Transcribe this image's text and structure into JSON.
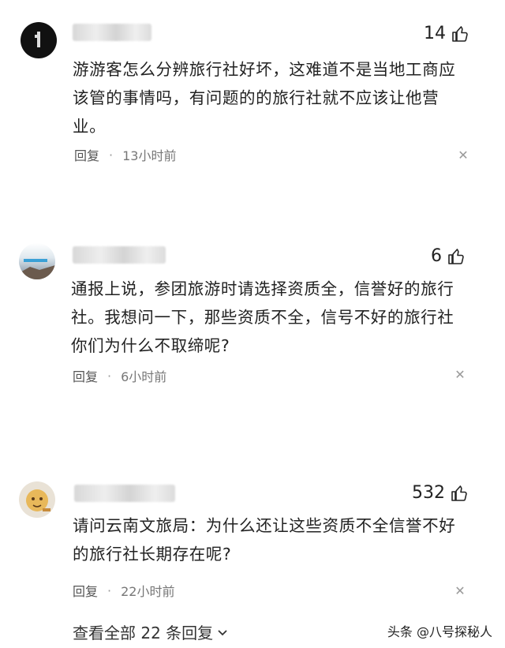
{
  "comments": [
    {
      "likes": "14",
      "text": "游游客怎么分辨旅行社好坏，这难道不是当地工商应该管的事情吗，有问题的的旅行社就不应该让他营业。",
      "reply_label": "回复",
      "time": "13小时前"
    },
    {
      "likes": "6",
      "text": "通报上说，参团旅游时请选择资质全，信誉好的旅行社。我想问一下，那些资质不全，信号不好的旅行社你们为什么不取缔呢?",
      "reply_label": "回复",
      "time": "6小时前"
    },
    {
      "likes": "532",
      "text": "请问云南文旅局：为什么还让这些资质不全信誉不好的旅行社长期存在呢?",
      "reply_label": "回复",
      "time": "22小时前"
    }
  ],
  "more_replies": "查看全部 22 条回复",
  "watermark": "头条 @八号探秘人"
}
